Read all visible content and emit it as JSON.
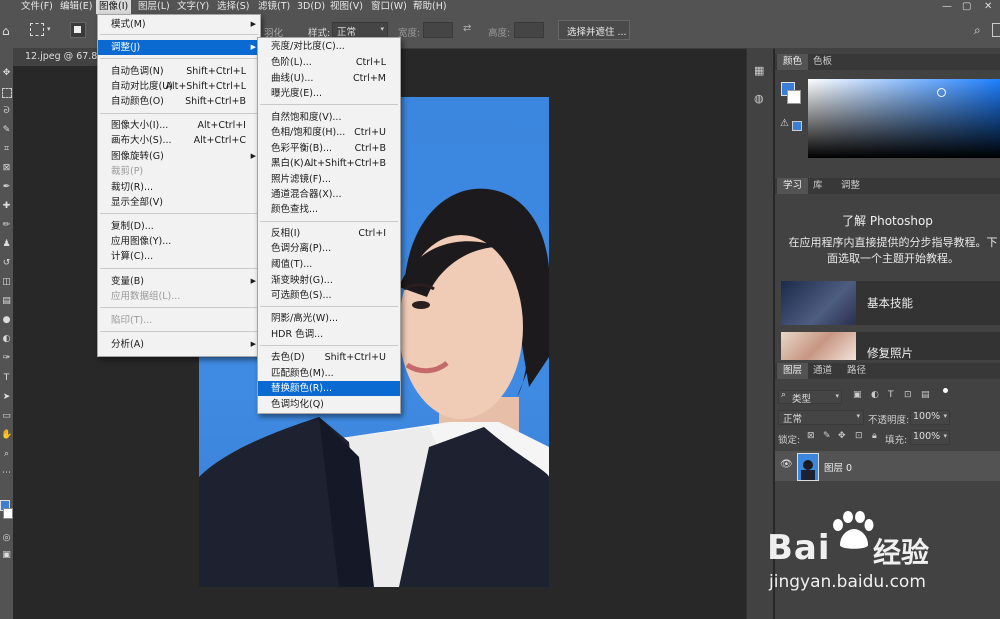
{
  "menubar": {
    "items": [
      "文件(F)",
      "编辑(E)",
      "图像(I)",
      "图层(L)",
      "文字(Y)",
      "选择(S)",
      "滤镜(T)",
      "3D(D)",
      "视图(V)",
      "窗口(W)",
      "帮助(H)"
    ]
  },
  "options": {
    "style_label": "样式:",
    "style_value": "正常",
    "width_label": "宽度:",
    "height_label": "高度:",
    "select_mask_button": "选择并遮住 ...",
    "feather_label": "羽化"
  },
  "document": {
    "tab_title": "12.jpeg @ 67.8%"
  },
  "image_menu": {
    "items": [
      {
        "label": "模式(M)",
        "shortcut": "",
        "submenu": true
      },
      {
        "label": "调整(J)",
        "shortcut": "",
        "submenu": true,
        "highlight": true
      },
      {
        "label": "自动色调(N)",
        "shortcut": "Shift+Ctrl+L"
      },
      {
        "label": "自动对比度(U)",
        "shortcut": "Alt+Shift+Ctrl+L"
      },
      {
        "label": "自动颜色(O)",
        "shortcut": "Shift+Ctrl+B"
      },
      {
        "label": "图像大小(I)...",
        "shortcut": "Alt+Ctrl+I"
      },
      {
        "label": "画布大小(S)...",
        "shortcut": "Alt+Ctrl+C"
      },
      {
        "label": "图像旋转(G)",
        "shortcut": "",
        "submenu": true
      },
      {
        "label": "裁剪(P)",
        "shortcut": "",
        "disabled": true
      },
      {
        "label": "裁切(R)...",
        "shortcut": ""
      },
      {
        "label": "显示全部(V)",
        "shortcut": ""
      },
      {
        "label": "复制(D)...",
        "shortcut": ""
      },
      {
        "label": "应用图像(Y)...",
        "shortcut": ""
      },
      {
        "label": "计算(C)...",
        "shortcut": ""
      },
      {
        "label": "变量(B)",
        "shortcut": "",
        "submenu": true
      },
      {
        "label": "应用数据组(L)...",
        "shortcut": "",
        "disabled": true
      },
      {
        "label": "陷印(T)...",
        "shortcut": "",
        "disabled": true
      },
      {
        "label": "分析(A)",
        "shortcut": "",
        "submenu": true
      }
    ]
  },
  "adjust_menu": {
    "items": [
      {
        "label": "亮度/对比度(C)...",
        "shortcut": ""
      },
      {
        "label": "色阶(L)...",
        "shortcut": "Ctrl+L"
      },
      {
        "label": "曲线(U)...",
        "shortcut": "Ctrl+M"
      },
      {
        "label": "曝光度(E)...",
        "shortcut": ""
      },
      {
        "label": "自然饱和度(V)...",
        "shortcut": ""
      },
      {
        "label": "色相/饱和度(H)...",
        "shortcut": "Ctrl+U"
      },
      {
        "label": "色彩平衡(B)...",
        "shortcut": "Ctrl+B"
      },
      {
        "label": "黑白(K)...",
        "shortcut": "Alt+Shift+Ctrl+B"
      },
      {
        "label": "照片滤镜(F)...",
        "shortcut": ""
      },
      {
        "label": "通道混合器(X)...",
        "shortcut": ""
      },
      {
        "label": "颜色查找...",
        "shortcut": ""
      },
      {
        "label": "反相(I)",
        "shortcut": "Ctrl+I"
      },
      {
        "label": "色调分离(P)...",
        "shortcut": ""
      },
      {
        "label": "阈值(T)...",
        "shortcut": ""
      },
      {
        "label": "渐变映射(G)...",
        "shortcut": ""
      },
      {
        "label": "可选颜色(S)...",
        "shortcut": ""
      },
      {
        "label": "阴影/高光(W)...",
        "shortcut": ""
      },
      {
        "label": "HDR 色调...",
        "shortcut": ""
      },
      {
        "label": "去色(D)",
        "shortcut": "Shift+Ctrl+U"
      },
      {
        "label": "匹配颜色(M)...",
        "shortcut": ""
      },
      {
        "label": "替换颜色(R)...",
        "shortcut": "",
        "highlight": true
      },
      {
        "label": "色调均化(Q)",
        "shortcut": ""
      }
    ]
  },
  "color_panel": {
    "tabs": [
      "颜色",
      "色板"
    ],
    "fg_color": "#3a7fd5"
  },
  "learn_panel": {
    "tabs": [
      "学习",
      "库",
      "调整"
    ],
    "title": "了解 Photoshop",
    "description": "在应用程序内直接提供的分步指导教程。下面选取一个主题开始教程。",
    "cards": [
      "基本技能",
      "修复照片"
    ]
  },
  "layers_panel": {
    "tabs": [
      "图层",
      "通道",
      "路径"
    ],
    "kind_label": "类型",
    "blend_mode": "正常",
    "opacity_label": "不透明度:",
    "opacity_value": "100%",
    "lock_label": "锁定:",
    "fill_label": "填充:",
    "fill_value": "100%",
    "layer_name": "图层 0"
  },
  "watermark": {
    "brand": "Bai",
    "brand2": "经验",
    "url": "jingyan.baidu.com"
  }
}
